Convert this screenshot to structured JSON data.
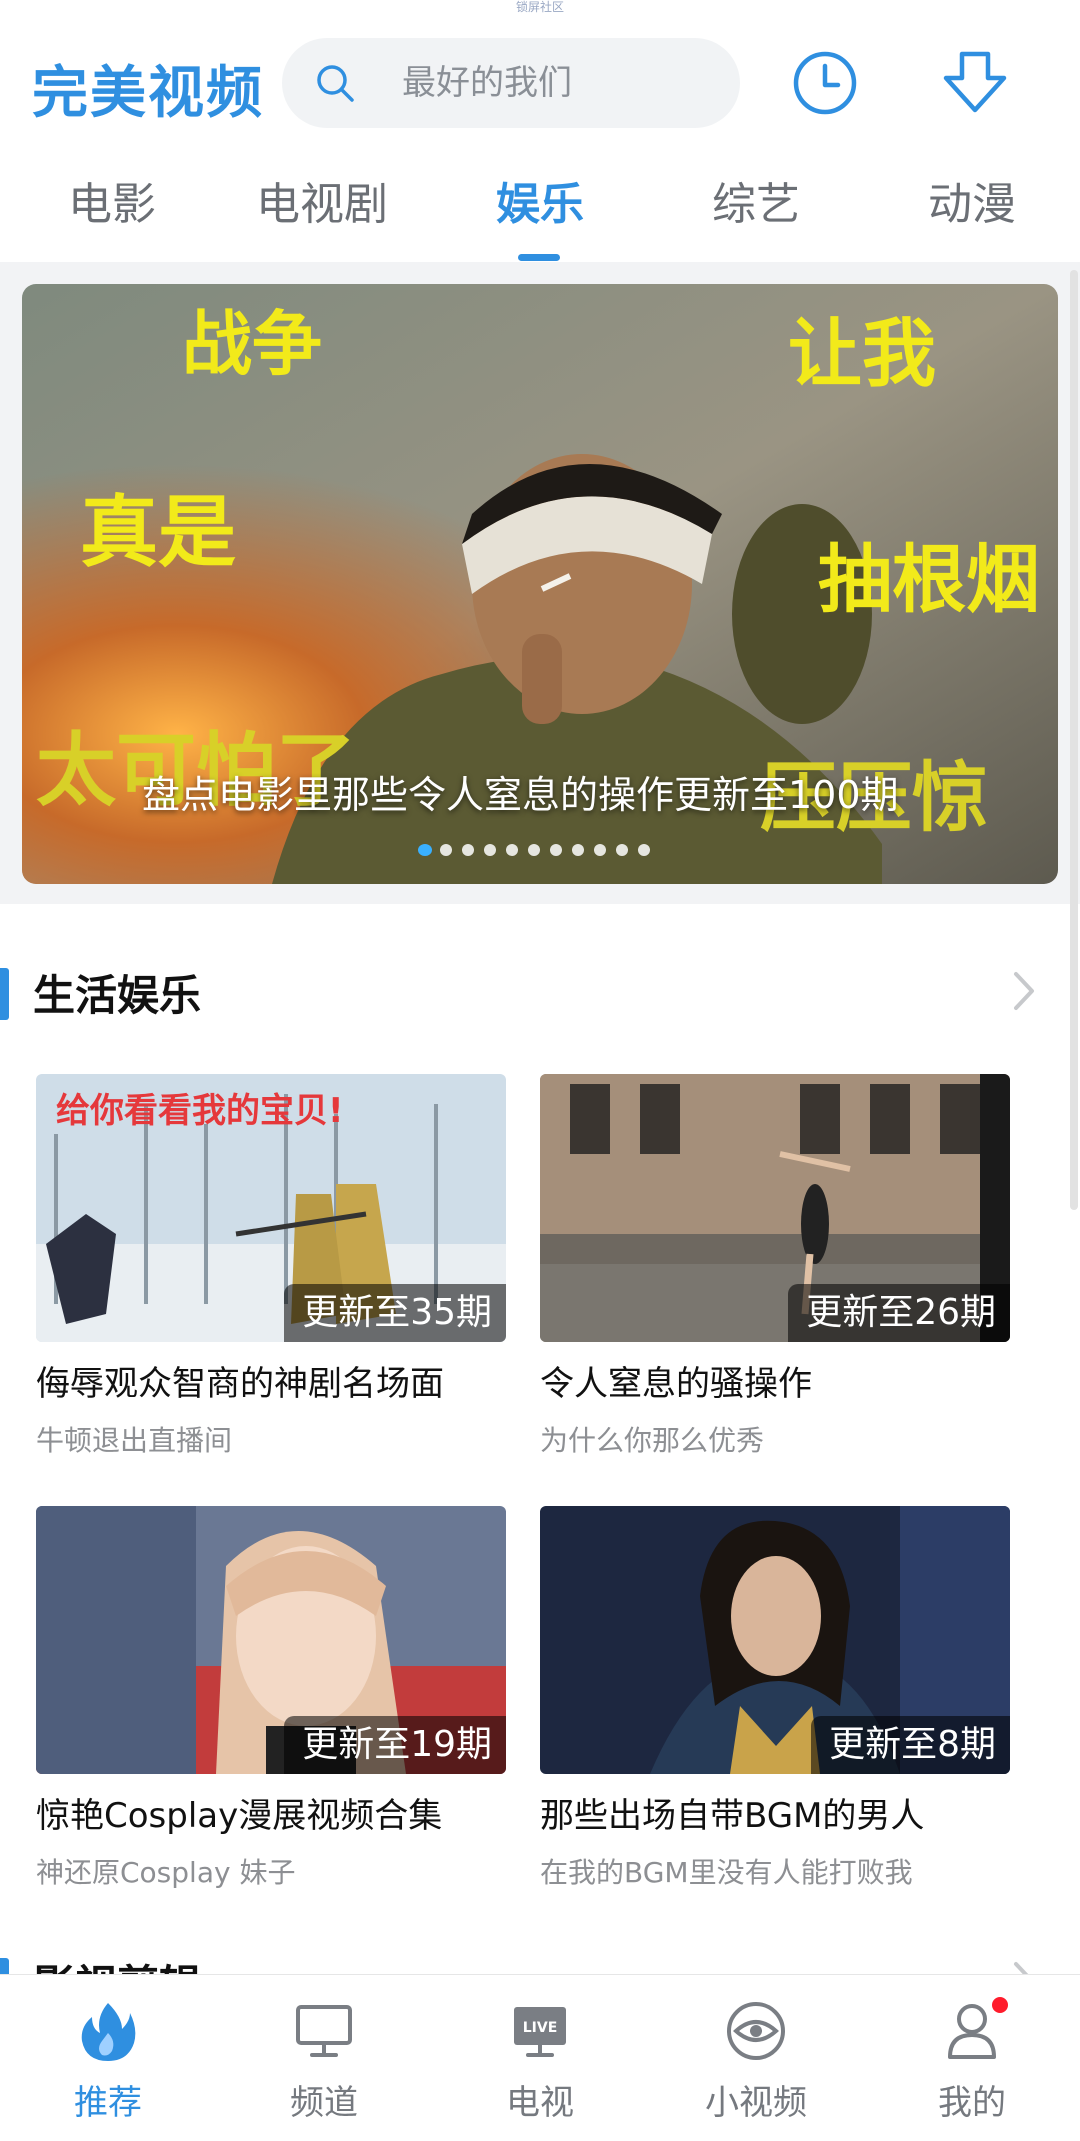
{
  "top_mini_label": "锁屏社区",
  "header": {
    "logo": "完美视频",
    "search_placeholder": "最好的我们"
  },
  "tabs": [
    {
      "label": "电影",
      "active": false
    },
    {
      "label": "电视剧",
      "active": false
    },
    {
      "label": "娱乐",
      "active": true
    },
    {
      "label": "综艺",
      "active": false
    },
    {
      "label": "动漫",
      "active": false
    }
  ],
  "banner": {
    "overlay_words": [
      "战争",
      "让我",
      "真是",
      "抽根烟",
      "太可怕了",
      "压压惊"
    ],
    "caption": "盘点电影里那些令人窒息的操作更新至100期",
    "dot_count": 11,
    "active_dot": 0
  },
  "sections": [
    {
      "title": "生活娱乐",
      "videos": [
        {
          "badge": "更新至35期",
          "title": "侮辱观众智商的神剧名场面",
          "subtitle": "牛顿退出直播间",
          "thumb_text": "给你看看我的宝贝!"
        },
        {
          "badge": "更新至26期",
          "title": "令人窒息的骚操作",
          "subtitle": "为什么你那么优秀"
        },
        {
          "badge": "更新至19期",
          "title": "惊艳Cosplay漫展视频合集",
          "subtitle": "神还原Cosplay 妹子"
        },
        {
          "badge": "更新至8期",
          "title": "那些出场自带BGM的男人",
          "subtitle": "在我的BGM里没有人能打败我"
        }
      ]
    },
    {
      "title": "影视剪辑"
    }
  ],
  "bottom_nav": [
    {
      "label": "推荐",
      "icon": "flame-icon",
      "active": true
    },
    {
      "label": "频道",
      "icon": "monitor-icon",
      "active": false
    },
    {
      "label": "电视",
      "icon": "live-tv-icon",
      "active": false,
      "icon_text": "LIVE"
    },
    {
      "label": "小视频",
      "icon": "eye-icon",
      "active": false
    },
    {
      "label": "我的",
      "icon": "user-icon",
      "active": false,
      "notification_dot": true
    }
  ],
  "colors": {
    "accent": "#2f8fe0",
    "banner_text": "#f2ea1a",
    "notification": "#ff1c2c"
  }
}
